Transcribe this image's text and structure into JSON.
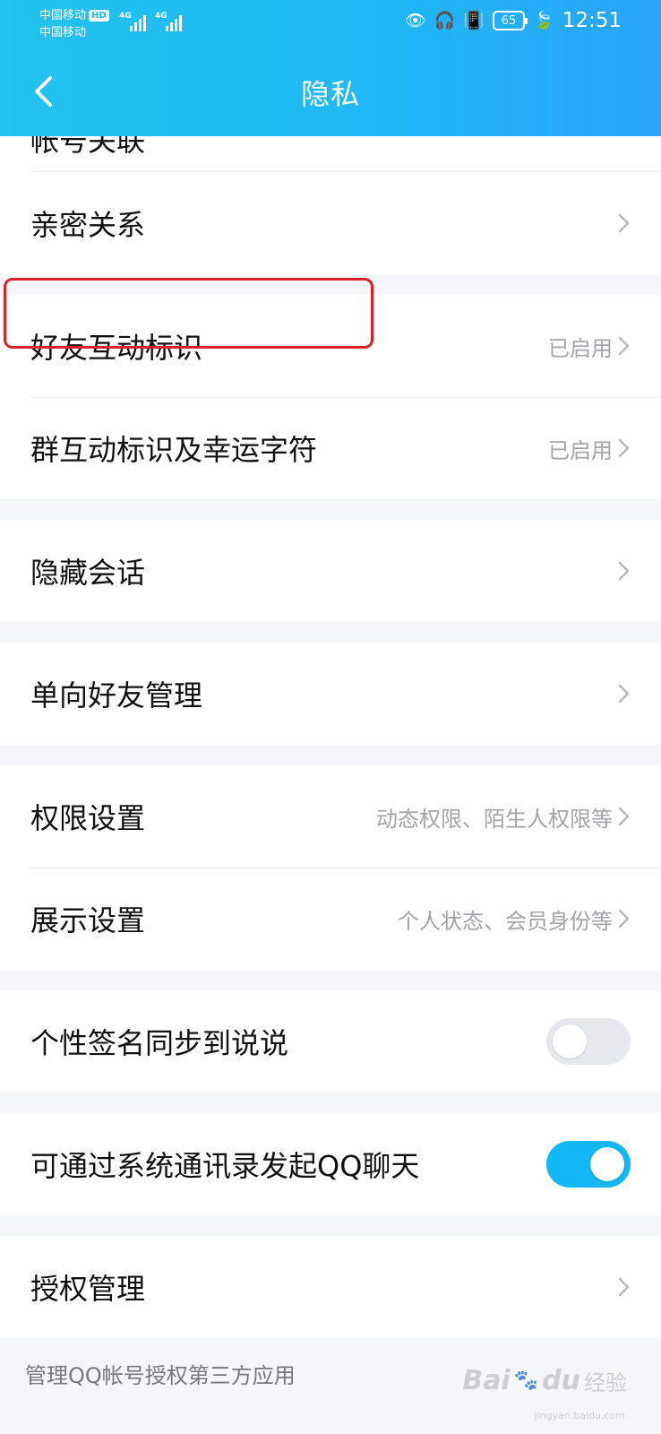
{
  "status_bar": {
    "carrier1": "中国移动",
    "hd_badge": "HD",
    "carrier2": "中国移动",
    "network1": "4G",
    "network2": "4G",
    "battery": "65",
    "time": "12:51"
  },
  "header": {
    "title": "隐私"
  },
  "list": {
    "partial_label": "帐号关联",
    "intimate": "亲密关系",
    "friend_interaction": {
      "label": "好友互动标识",
      "value": "已启用"
    },
    "group_interaction": {
      "label": "群互动标识及幸运字符",
      "value": "已启用"
    },
    "hidden_chats": "隐藏会话",
    "one_way_friends": "单向好友管理",
    "permissions": {
      "label": "权限设置",
      "value": "动态权限、陌生人权限等"
    },
    "display": {
      "label": "展示设置",
      "value": "个人状态、会员身份等"
    },
    "signature_sync": {
      "label": "个性签名同步到说说",
      "enabled": false
    },
    "contacts_chat": {
      "label": "可通过系统通讯录发起QQ聊天",
      "enabled": true
    },
    "authorization": "授权管理"
  },
  "footer": {
    "description": "管理QQ帐号授权第三方应用"
  },
  "watermark": {
    "brand": "Bai",
    "brand2": "du",
    "suffix": "经验",
    "url": "jingyan.baidu.com"
  },
  "colors": {
    "header": "#1fb6f6",
    "toggle_on": "#12b7f5",
    "highlight": "#d9212c"
  }
}
